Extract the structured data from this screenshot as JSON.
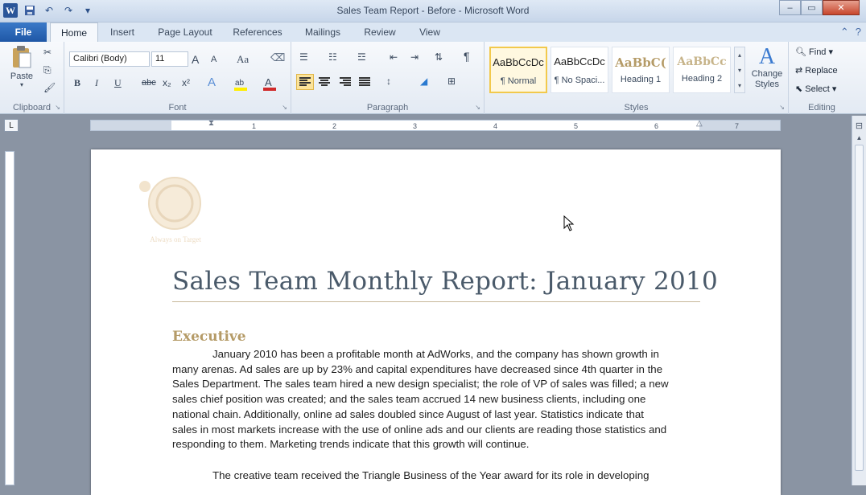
{
  "window": {
    "title": "Sales Team Report - Before - Microsoft Word"
  },
  "tabs": {
    "file": "File",
    "items": [
      "Home",
      "Insert",
      "Page Layout",
      "References",
      "Mailings",
      "Review",
      "View"
    ]
  },
  "ribbon": {
    "clipboard": {
      "label": "Clipboard",
      "paste": "Paste"
    },
    "font": {
      "label": "Font",
      "family": "Calibri (Body)",
      "size": "11",
      "grow": "A",
      "shrink": "A",
      "case": "Aa",
      "bold": "B",
      "italic": "I",
      "underline": "U",
      "strike": "abc",
      "sub": "x₂",
      "sup": "x²"
    },
    "paragraph": {
      "label": "Paragraph",
      "pilcrow": "¶"
    },
    "styles": {
      "label": "Styles",
      "items": [
        {
          "sample": "AaBbCcDc",
          "name": "¶ Normal"
        },
        {
          "sample": "AaBbCcDc",
          "name": "¶ No Spaci..."
        },
        {
          "sample": "AaBbC(",
          "name": "Heading 1"
        },
        {
          "sample": "AaBbCc",
          "name": "Heading 2"
        }
      ],
      "change": "Change Styles"
    },
    "editing": {
      "label": "Editing",
      "find": "Find",
      "replace": "Replace",
      "select": "Select"
    }
  },
  "ruler": {
    "numbers": [
      "1",
      "2",
      "3",
      "4",
      "5",
      "6",
      "7"
    ]
  },
  "document": {
    "logo_text": "Always on Target",
    "title": "Sales Team Monthly Report: January 2010",
    "heading": "Executive",
    "para1_lines": [
      "January 2010  has been a profitable month at AdWorks, and the company has shown growth in",
      "many arenas. Ad sales are up by 23% and capital expenditures have decreased since 4th quarter in the",
      "Sales Department. The sales team hired a new design specialist; the role of VP of sales was filled; a new",
      "sales chief position was created; and the sales team accrued 14  new business clients, including one",
      "national chain. Additionally, online ad sales doubled since August of last year. Statistics indicate that",
      "sales in  most markets increase with the use of online ads and our clients are reading those statistics and",
      "responding to them. Marketing trends indicate that this growth will continue."
    ],
    "para2_line": "The creative team received the Triangle Business of the Year award for its role in developing"
  },
  "colors": {
    "heading": "#b59b67",
    "title": "#4a5a6a",
    "accent": "#2a5599"
  }
}
